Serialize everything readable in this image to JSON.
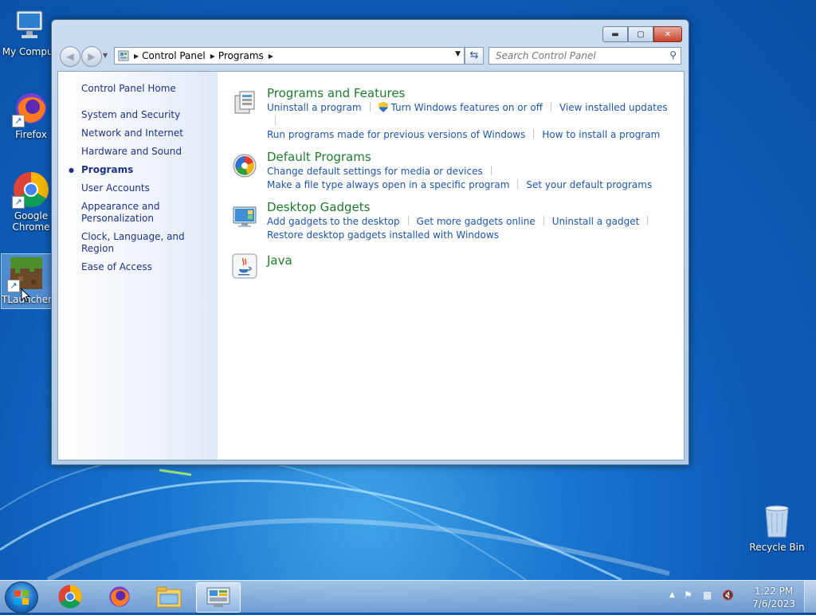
{
  "desktop": {
    "icons": [
      {
        "label": "My Comput",
        "icon": "computer-icon"
      },
      {
        "label": "Firefox",
        "icon": "firefox-icon"
      },
      {
        "label": "Google Chrome",
        "icon": "chrome-icon"
      },
      {
        "label": "TLauncher",
        "icon": "minecraft-grass-block-icon"
      }
    ],
    "recycle_bin": {
      "label": "Recycle Bin",
      "icon": "recycle-bin-icon"
    }
  },
  "window": {
    "caption_buttons": {
      "minimize": "minimize-icon",
      "maximize": "maximize-icon",
      "close": "close-icon"
    },
    "breadcrumb": [
      "Control Panel",
      "Programs"
    ],
    "search_placeholder": "Search Control Panel",
    "left_pane": {
      "home": "Control Panel Home",
      "items": [
        "System and Security",
        "Network and Internet",
        "Hardware and Sound",
        "Programs",
        "User Accounts",
        "Appearance and Personalization",
        "Clock, Language, and Region",
        "Ease of Access"
      ],
      "current": "Programs"
    },
    "categories": [
      {
        "title": "Programs and Features",
        "icon": "programs-features-icon",
        "links": [
          "Uninstall a program",
          "Turn Windows features on or off",
          "View installed updates",
          "Run programs made for previous versions of Windows",
          "How to install a program"
        ]
      },
      {
        "title": "Default Programs",
        "icon": "default-programs-icon",
        "links": [
          "Change default settings for media or devices",
          "Make a file type always open in a specific program",
          "Set your default programs"
        ]
      },
      {
        "title": "Desktop Gadgets",
        "icon": "desktop-gadgets-icon",
        "links": [
          "Add gadgets to the desktop",
          "Get more gadgets online",
          "Uninstall a gadget",
          "Restore desktop gadgets installed with Windows"
        ]
      },
      {
        "title": "Java",
        "icon": "java-icon",
        "links": []
      }
    ]
  },
  "taskbar": {
    "pinned": [
      "chrome-icon",
      "firefox-icon",
      "file-explorer-icon",
      "control-panel-icon"
    ],
    "clock": {
      "time": "1:22 PM",
      "date": "7/6/2023"
    }
  }
}
